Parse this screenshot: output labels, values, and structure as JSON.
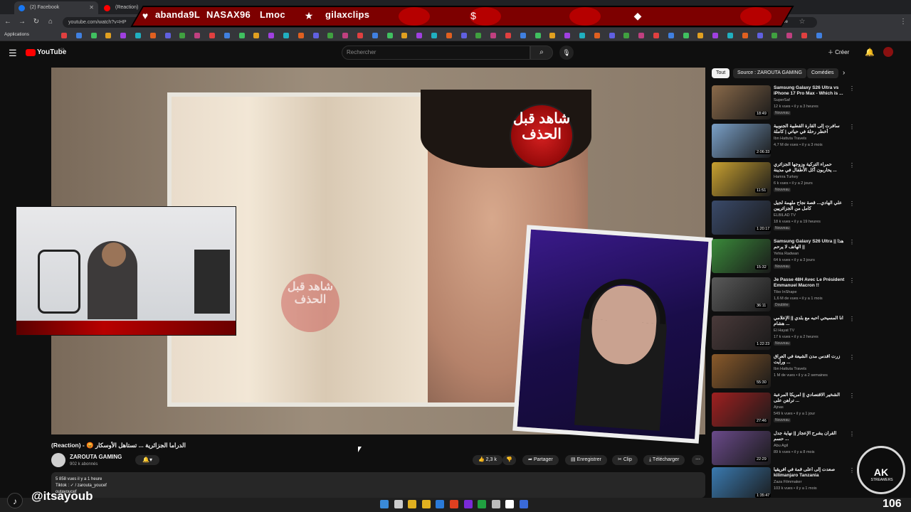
{
  "browser": {
    "tabs": [
      {
        "label": "(2) Facebook"
      },
      {
        "label": "(Reaction)"
      }
    ],
    "address": "youtube.com/watch?v=HP",
    "bookmarks_label": "Applications",
    "google_label": "Google"
  },
  "overlay": {
    "items": [
      "abanda9L",
      "NASAX96",
      "Lmoc",
      "gilaxclips"
    ],
    "colors": {
      "banner": "#7d0000",
      "accent": "#c00000"
    }
  },
  "youtube": {
    "logo": "YouTube",
    "logo_region": "CA",
    "search_placeholder": "Rechercher",
    "create_label": "Créer"
  },
  "video": {
    "badge_text": "شاهد قبل الحذف",
    "title": "(Reaction) - 😡 الدراما الجزائرية ... تستاهل الأوسكار",
    "channel": "ZAROUTA GAMING",
    "subscribers": "902 k abonnés",
    "likes": "2,3 k",
    "actions": {
      "share": "Partager",
      "save": "Enregistrer",
      "clip": "Clip",
      "download": "Télécharger"
    },
    "description": {
      "stats": "5 858 vues  il y a 1 heure",
      "line2": "Tiktok : ✓ / zarouta_youcef",
      "line3": "outayoucef"
    }
  },
  "chips": [
    "Tout",
    "Source : ZAROUTA GAMING",
    "Comédies"
  ],
  "recommendations": [
    {
      "title": "Samsung Galaxy S26 Ultra vs iPhone 17 Pro Max - Which is ...",
      "channel": "SuperSaf",
      "views": "12 k vues • il y a 3 heures",
      "badge": "Nouveau",
      "duration": "18:49",
      "color": "#8a6a4a"
    },
    {
      "title": "سافرت إلى القارة القطبية الجنوبية أخطر رحلة في حياتي | كاملة",
      "channel": "Ibn Hattuta Travels",
      "views": "4,7 M de vues • il y a 3 mois",
      "badge": "",
      "duration": "2:06:33",
      "color": "#7aa0c8"
    },
    {
      "title": "حمراء التركية وزوجها الجزائري يحاربون أكل الأطفال في مدينة ...",
      "channel": "Hamra Turkey",
      "views": "6 k vues • il y a 2 jours",
      "badge": "Nouveau",
      "duration": "11:51",
      "color": "#c8a030"
    },
    {
      "title": "علي الهادي... قصة نجاح ملهمة لجيل كامل من الجزائريين",
      "channel": "ELBILAD TV",
      "views": "18 k vues • il y a 19 heures",
      "badge": "Nouveau",
      "duration": "1:20:17",
      "color": "#3a4a6a"
    },
    {
      "title": "Samsung Galaxy S26 Ultra || هذا الهاتف لا يرحم ||",
      "channel": "Yehia Radwan",
      "views": "64 k vues • il y a 3 jours",
      "badge": "Nouveau",
      "duration": "15:32",
      "color": "#3a8a3a"
    },
    {
      "title": "Je Passe 48H Avec Le Président Emmanuel Macron !!",
      "channel": "Tibo InShape",
      "views": "1,6 M de vues • il y a 1 mois",
      "badge": "Doublée",
      "duration": "36:11",
      "color": "#5a5a5a"
    },
    {
      "title": "أنا المسيحي أحبه مع بلدي || الإعلامي هشام ...",
      "channel": "El Hayat TV",
      "views": "17 k vues • il y a 2 heures",
      "badge": "Nouveau",
      "duration": "1:22:23",
      "color": "#4a3a3a"
    },
    {
      "title": "زرت أقدس مدن الشيعة في العراق ورأيت ...",
      "channel": "Ibn Hattuta Travels",
      "views": "1 M de vues • il y a 2 semaines",
      "badge": "",
      "duration": "55:30",
      "color": "#8a5a2a"
    },
    {
      "title": "الشخير الاقتصادي || أمريكا المرعبة تراهن على ...",
      "channel": "Ajnas",
      "views": "549 k vues • il y a 1 jour",
      "badge": "Nouveau",
      "duration": "27:46",
      "color": "#a02020"
    },
    {
      "title": "القرآن يشرح الإعجاز || نهاية جدل حسم ...",
      "channel": "Abu Agil",
      "views": "89 k vues • il y a 8 mois",
      "badge": "",
      "duration": "22:29",
      "color": "#6a4a8a"
    },
    {
      "title": "صعدت إلى أعلى قمة في أفريقيا kilimanjaro Tanzania",
      "channel": "Zaza Filmmaker",
      "views": "103 k vues • il y a 1 mois",
      "badge": "",
      "duration": "1:35:47",
      "color": "#3a7ab0"
    }
  ],
  "stream": {
    "handle": "@itsayoub",
    "logo_text": "AK",
    "logo_sub": "STREAMERS",
    "counter": "106"
  }
}
